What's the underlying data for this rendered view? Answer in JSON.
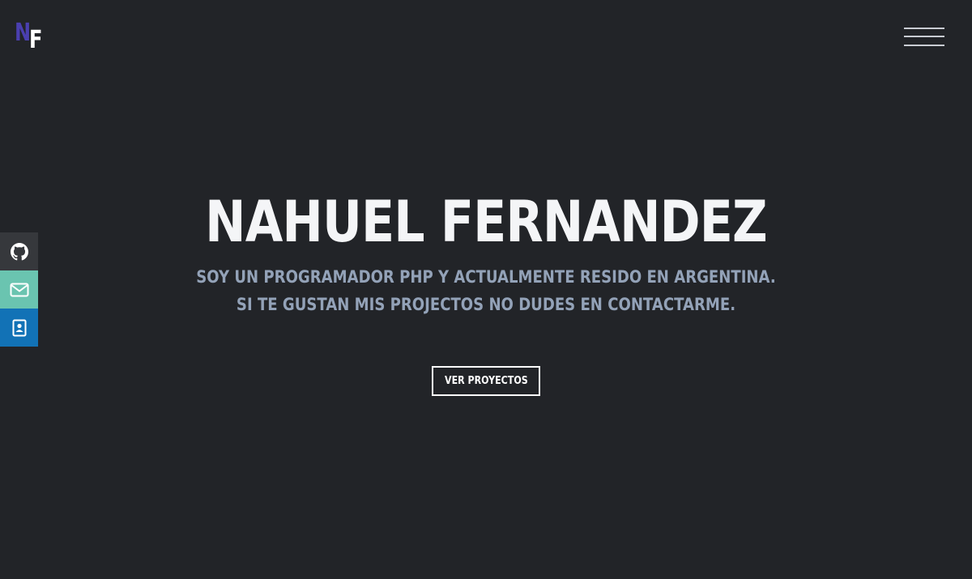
{
  "logo": {
    "letter_n": "N",
    "letter_f": "F",
    "n_color": "#4a3fb0",
    "f_color": "#ffffff"
  },
  "nav": {
    "menu_icon": "hamburger-menu-icon"
  },
  "social": [
    {
      "name": "github",
      "icon": "github-icon",
      "color": "#36383c"
    },
    {
      "name": "mail",
      "icon": "envelope-icon",
      "color": "#6ac4b0"
    },
    {
      "name": "contact",
      "icon": "contact-card-icon",
      "color": "#1272b6"
    }
  ],
  "hero": {
    "title": "NAHUEL FERNANDEZ",
    "subtitle_line1": "SOY UN PROGRAMADOR PHP Y ACTUALMENTE RESIDO EN ARGENTINA.",
    "subtitle_line2": "SI TE GUSTAN MIS PROJECTOS NO DUDES EN CONTACTARME.",
    "cta_label": "VER PROYECTOS"
  },
  "colors": {
    "background": "#222428",
    "title": "#f4f5f7",
    "subtitle": "#93a2b8"
  }
}
